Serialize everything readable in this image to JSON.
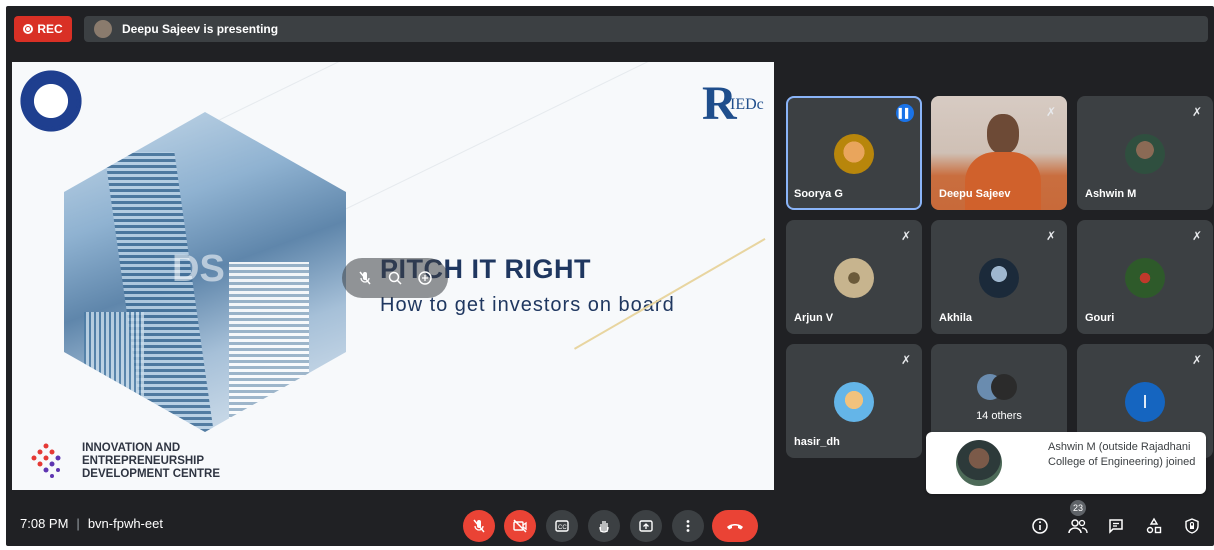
{
  "recording": {
    "label": "REC"
  },
  "presenting": {
    "text": "Deepu Sajeev is presenting"
  },
  "slide": {
    "title": "PITCH IT RIGHT",
    "subtitle": "How to get investors on board",
    "watermark": "DS",
    "org_line1": "INNOVATION AND",
    "org_line2": "ENTREPRENEURSHIP",
    "org_line3": "DEVELOPMENT CENTRE",
    "brand_R": "R",
    "brand_rest": "IEDc"
  },
  "participants": [
    {
      "name": "Soorya G",
      "state": "speaking",
      "avatar_color": "#b8860b"
    },
    {
      "name": "Deepu Sajeev",
      "state": "muted",
      "video": true
    },
    {
      "name": "Ashwin M",
      "state": "muted",
      "avatar_color": "#2f4f3f"
    },
    {
      "name": "Arjun V",
      "state": "muted",
      "avatar_color": "#c7b48e"
    },
    {
      "name": "Akhila",
      "state": "muted",
      "avatar_color": "#1b2a3a"
    },
    {
      "name": "Gouri",
      "state": "muted",
      "avatar_color": "#2e5a2a"
    },
    {
      "name": "hasir_dh",
      "state": "muted",
      "avatar_color": "#64b5e8"
    },
    {
      "name": "14 others",
      "state": "group"
    },
    {
      "name": "I",
      "state": "muted",
      "avatar_color": "#1565c0"
    }
  ],
  "notification": {
    "text": "Ashwin M (outside Rajadhani College of Engineering) joined"
  },
  "meeting": {
    "time": "7:08 PM",
    "separator": "|",
    "code": "bvn-fpwh-eet"
  },
  "people_count": "23",
  "colors": {
    "accent": "#1a73e8",
    "danger": "#ea4335",
    "tile": "#3c4043",
    "bg": "#202124"
  }
}
